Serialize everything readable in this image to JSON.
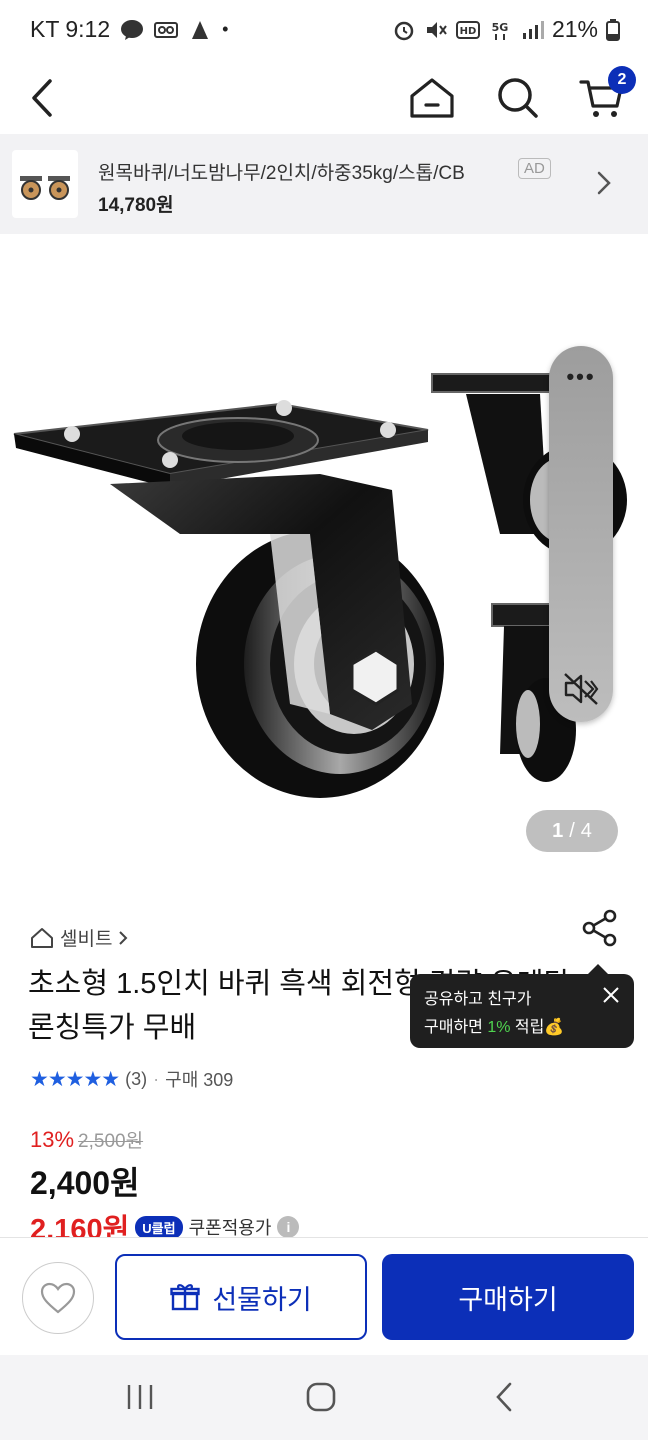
{
  "status_bar": {
    "carrier_time": "KT 9:12",
    "battery": "21%"
  },
  "header": {
    "cart_count": "2"
  },
  "ad_banner": {
    "title": "원목바퀴/너도밤나무/2인치/하중35kg/스톱/CB",
    "tag": "AD",
    "price": "14,780원"
  },
  "image": {
    "current": "1",
    "separator": "/",
    "total": "4"
  },
  "edge_panel": {
    "menu": "•••"
  },
  "product": {
    "store": "셀비트",
    "title": "초소형 1.5인치 바퀴 흑색 회전형 경량 우레탄  론칭특가 무배",
    "rating_count": "(3)",
    "purchase_label": "구매 309",
    "discount": "13%",
    "original_price": "2,500원",
    "price": "2,400원",
    "coupon_price": "2,160원",
    "uclub_label": "U클럽",
    "coupon_label": "쿠폰적용가",
    "info_symbol": "i"
  },
  "tooltip": {
    "line1": "공유하고 친구가",
    "line2_prefix": "구매하면 ",
    "line2_percent": "1%",
    "line2_suffix": " 적립",
    "emoji": "💰"
  },
  "actions": {
    "gift_label": "선물하기",
    "buy_label": "구매하기"
  },
  "icons": {
    "back": "back-arrow-icon",
    "home": "home-icon",
    "search": "search-icon",
    "cart": "cart-icon",
    "share": "share-icon",
    "heart": "heart-icon",
    "gift": "gift-icon"
  },
  "colors": {
    "brand_blue": "#0c2fb8",
    "discount_red": "#e02020",
    "star_blue": "#1f5fe0",
    "tooltip_green": "#4fd34f"
  }
}
